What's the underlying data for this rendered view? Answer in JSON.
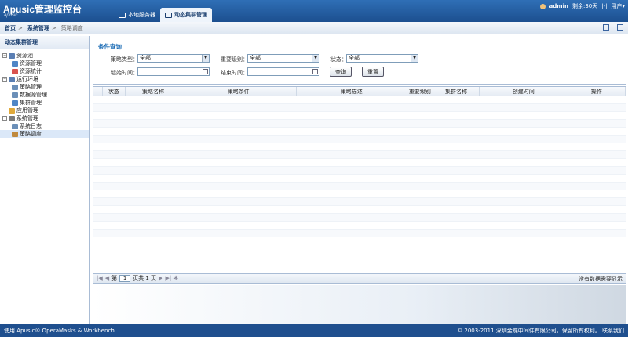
{
  "app": {
    "logo": "Apusic管理监控台",
    "logo_sub": "apusic"
  },
  "tabs": [
    {
      "label": "本地服务器",
      "active": false
    },
    {
      "label": "动态集群管理",
      "active": true
    }
  ],
  "user": {
    "name": "admin",
    "remaining": "剩余:30天",
    "sep": "|-|",
    "menu": "用户▾"
  },
  "breadcrumb": {
    "home": "首页",
    "sep1": ">",
    "section": "系统管理",
    "sep2": ">",
    "current": "策略调度"
  },
  "sidebar": {
    "title": "动态集群管理",
    "items": [
      {
        "label": "资源池",
        "level": 0,
        "exp": "⊟",
        "color": "#5b7fb3"
      },
      {
        "label": "资源管理",
        "level": 1,
        "color": "#4f86c6"
      },
      {
        "label": "资源统计",
        "level": 1,
        "color": "#d9534f"
      },
      {
        "label": "运行环境",
        "level": 0,
        "exp": "⊟",
        "color": "#5b7fb3"
      },
      {
        "label": "策略管理",
        "level": 1,
        "color": "#6b8fb8"
      },
      {
        "label": "数据源管理",
        "level": 1,
        "color": "#6b8fb8"
      },
      {
        "label": "集群管理",
        "level": 1,
        "color": "#4f86c6"
      },
      {
        "label": "应用管理",
        "level": 0,
        "exp": "",
        "color": "#e0a93a"
      },
      {
        "label": "系统管理",
        "level": 0,
        "exp": "⊟",
        "color": "#7a7a7a"
      },
      {
        "label": "系统日志",
        "level": 1,
        "color": "#6b8fb8"
      },
      {
        "label": "策略调度",
        "level": 1,
        "color": "#c08a3e",
        "selected": true
      }
    ]
  },
  "query": {
    "title": "条件查询",
    "type_label": "策略类型：",
    "type_value": "全部",
    "level_label": "重要级别：",
    "level_value": "全部",
    "status_label": "状态：",
    "status_value": "全部",
    "start_label": "起始时间：",
    "end_label": "结束时间：",
    "search_btn": "查询",
    "reset_btn": "重置"
  },
  "table": {
    "columns": [
      "状态",
      "策略名称",
      "策略条件",
      "策略描述",
      "重要级别",
      "集群名称",
      "创建时间",
      "操作"
    ]
  },
  "pager": {
    "page": "1",
    "pre": "第",
    "post": "页共 1 页",
    "msg": "没有数据需要显示"
  },
  "footer": {
    "left": "使用 Apusic® OperaMasks & Workbench",
    "right": "© 2003-2011 深圳金蝶中间件有限公司，保留所有权利。 联系我们"
  }
}
